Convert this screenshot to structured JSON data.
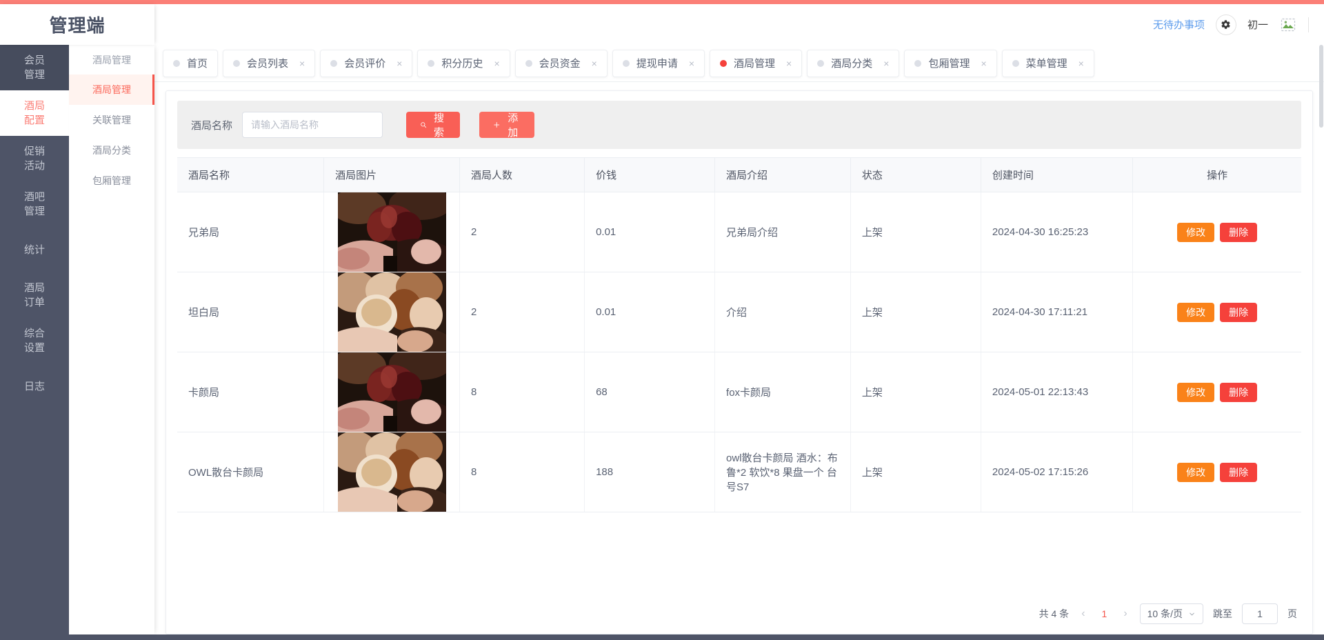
{
  "header": {
    "logo": "管理端",
    "todo_link": "无待办事项",
    "gear_icon": "gear-icon",
    "user_name": "初一",
    "avatar_icon": "broken-image-icon"
  },
  "sidebar1": {
    "items": [
      {
        "line1": "会员",
        "line2": "管理",
        "state": "dark"
      },
      {
        "line1": "酒局",
        "line2": "配置",
        "state": "active"
      },
      {
        "line1": "促销",
        "line2": "活动",
        "state": "normal"
      },
      {
        "line1": "酒吧",
        "line2": "管理",
        "state": "normal"
      },
      {
        "line1": "统计",
        "line2": "",
        "state": "normal"
      },
      {
        "line1": "酒局",
        "line2": "订单",
        "state": "normal"
      },
      {
        "line1": "综合",
        "line2": "设置",
        "state": "normal"
      },
      {
        "line1": "日志",
        "line2": "",
        "state": "normal"
      }
    ]
  },
  "sidebar2": {
    "title": "酒局管理",
    "items": [
      {
        "label": "酒局管理",
        "active": true
      },
      {
        "label": "关联管理",
        "active": false
      },
      {
        "label": "酒局分类",
        "active": false
      },
      {
        "label": "包厢管理",
        "active": false
      }
    ]
  },
  "tabs": [
    {
      "label": "首页",
      "active": false,
      "closable": false
    },
    {
      "label": "会员列表",
      "active": false,
      "closable": true
    },
    {
      "label": "会员评价",
      "active": false,
      "closable": true
    },
    {
      "label": "积分历史",
      "active": false,
      "closable": true
    },
    {
      "label": "会员资金",
      "active": false,
      "closable": true
    },
    {
      "label": "提现申请",
      "active": false,
      "closable": true
    },
    {
      "label": "酒局管理",
      "active": true,
      "closable": true
    },
    {
      "label": "酒局分类",
      "active": false,
      "closable": true
    },
    {
      "label": "包厢管理",
      "active": false,
      "closable": true
    },
    {
      "label": "菜单管理",
      "active": false,
      "closable": true
    }
  ],
  "filter": {
    "label": "酒局名称",
    "input_value": "",
    "input_placeholder": "请输入酒局名称",
    "search_label": "搜索",
    "search_icon": "search-icon",
    "add_label": "添加",
    "add_icon": "plus-icon"
  },
  "table": {
    "columns": [
      "酒局名称",
      "酒局图片",
      "酒局人数",
      "价钱",
      "酒局介绍",
      "状态",
      "创建时间",
      "操作"
    ],
    "rows": [
      {
        "name": "兄弟局",
        "image": "wine-glasses-toast-photo",
        "people": "2",
        "price": "0.01",
        "intro": "兄弟局介绍",
        "status": "上架",
        "created": "2024-04-30 16:25:23",
        "edit_label": "修改",
        "delete_label": "删除"
      },
      {
        "name": "坦白局",
        "image": "beer-glasses-toast-photo",
        "people": "2",
        "price": "0.01",
        "intro": "介绍",
        "status": "上架",
        "created": "2024-04-30 17:11:21",
        "edit_label": "修改",
        "delete_label": "删除"
      },
      {
        "name": "卡颜局",
        "image": "wine-glasses-toast-photo",
        "people": "8",
        "price": "68",
        "intro": "fox卡颜局",
        "status": "上架",
        "created": "2024-05-01 22:13:43",
        "edit_label": "修改",
        "delete_label": "删除"
      },
      {
        "name": "OWL散台卡颜局",
        "image": "beer-glasses-toast-photo",
        "people": "8",
        "price": "188",
        "intro": "owl散台卡颜局 酒水：布鲁*2 软饮*8 果盘一个 台号S7",
        "status": "上架",
        "created": "2024-05-02 17:15:26",
        "edit_label": "修改",
        "delete_label": "删除"
      }
    ]
  },
  "pagination": {
    "total_text": "共 4 条",
    "prev_icon": "chevron-left-icon",
    "current_page": "1",
    "next_icon": "chevron-right-icon",
    "page_size_label": "10 条/页",
    "jump_label": "跳至",
    "jump_value": "1",
    "page_unit": "页"
  },
  "colors": {
    "accent": "#fb7f77",
    "brand_red": "#f5413b",
    "edit_orange": "#fa8219",
    "sidebar_dark": "#4e5467",
    "link_blue": "#5d9cec"
  }
}
